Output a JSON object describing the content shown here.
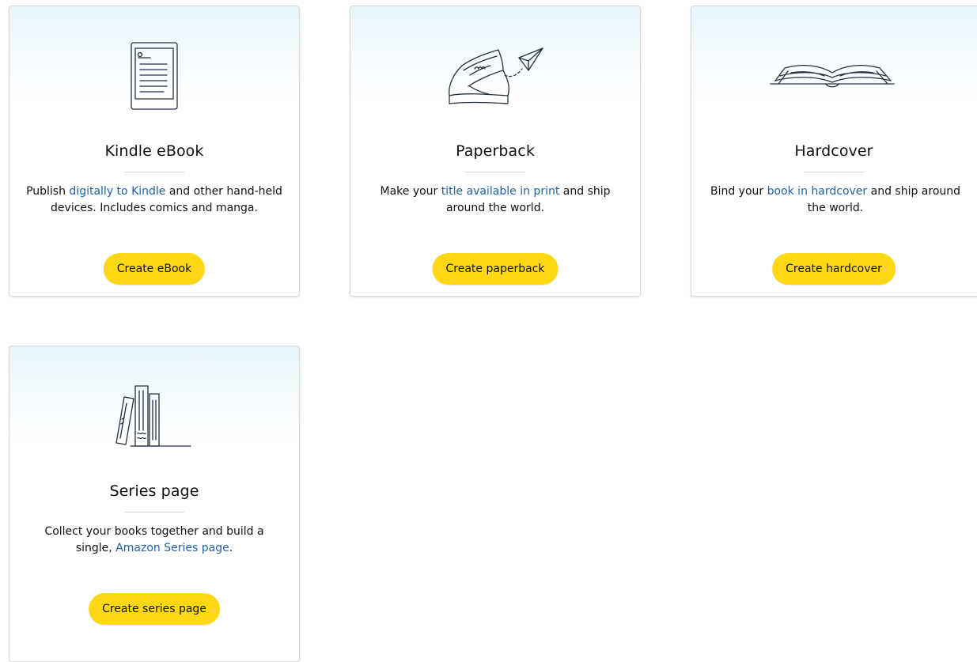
{
  "cards": [
    {
      "id": "ebook",
      "title": "Kindle eBook",
      "desc_before": "Publish ",
      "desc_link": "digitally to Kindle",
      "desc_after": " and other hand-held devices. Includes comics and manga.",
      "button": "Create eBook",
      "icon": "kindle-device-icon"
    },
    {
      "id": "paperback",
      "title": "Paperback",
      "desc_before": "Make your ",
      "desc_link": "title available in print",
      "desc_after": " and ship around the world.",
      "button": "Create paperback",
      "icon": "paperback-book-plane-icon"
    },
    {
      "id": "hardcover",
      "title": "Hardcover",
      "desc_before": "Bind your ",
      "desc_link": "book in hardcover",
      "desc_after": " and ship around the world.",
      "button": "Create hardcover",
      "icon": "open-book-icon"
    },
    {
      "id": "series",
      "title": "Series page",
      "desc_before": "Collect your books together and build a single, ",
      "desc_link": "Amazon Series page",
      "desc_after": ".",
      "button": "Create series page",
      "icon": "book-stack-icon"
    }
  ],
  "colors": {
    "button_bg": "#ffd814",
    "link": "#2162a1",
    "text": "#0f1111",
    "border": "#d5d9d9"
  }
}
